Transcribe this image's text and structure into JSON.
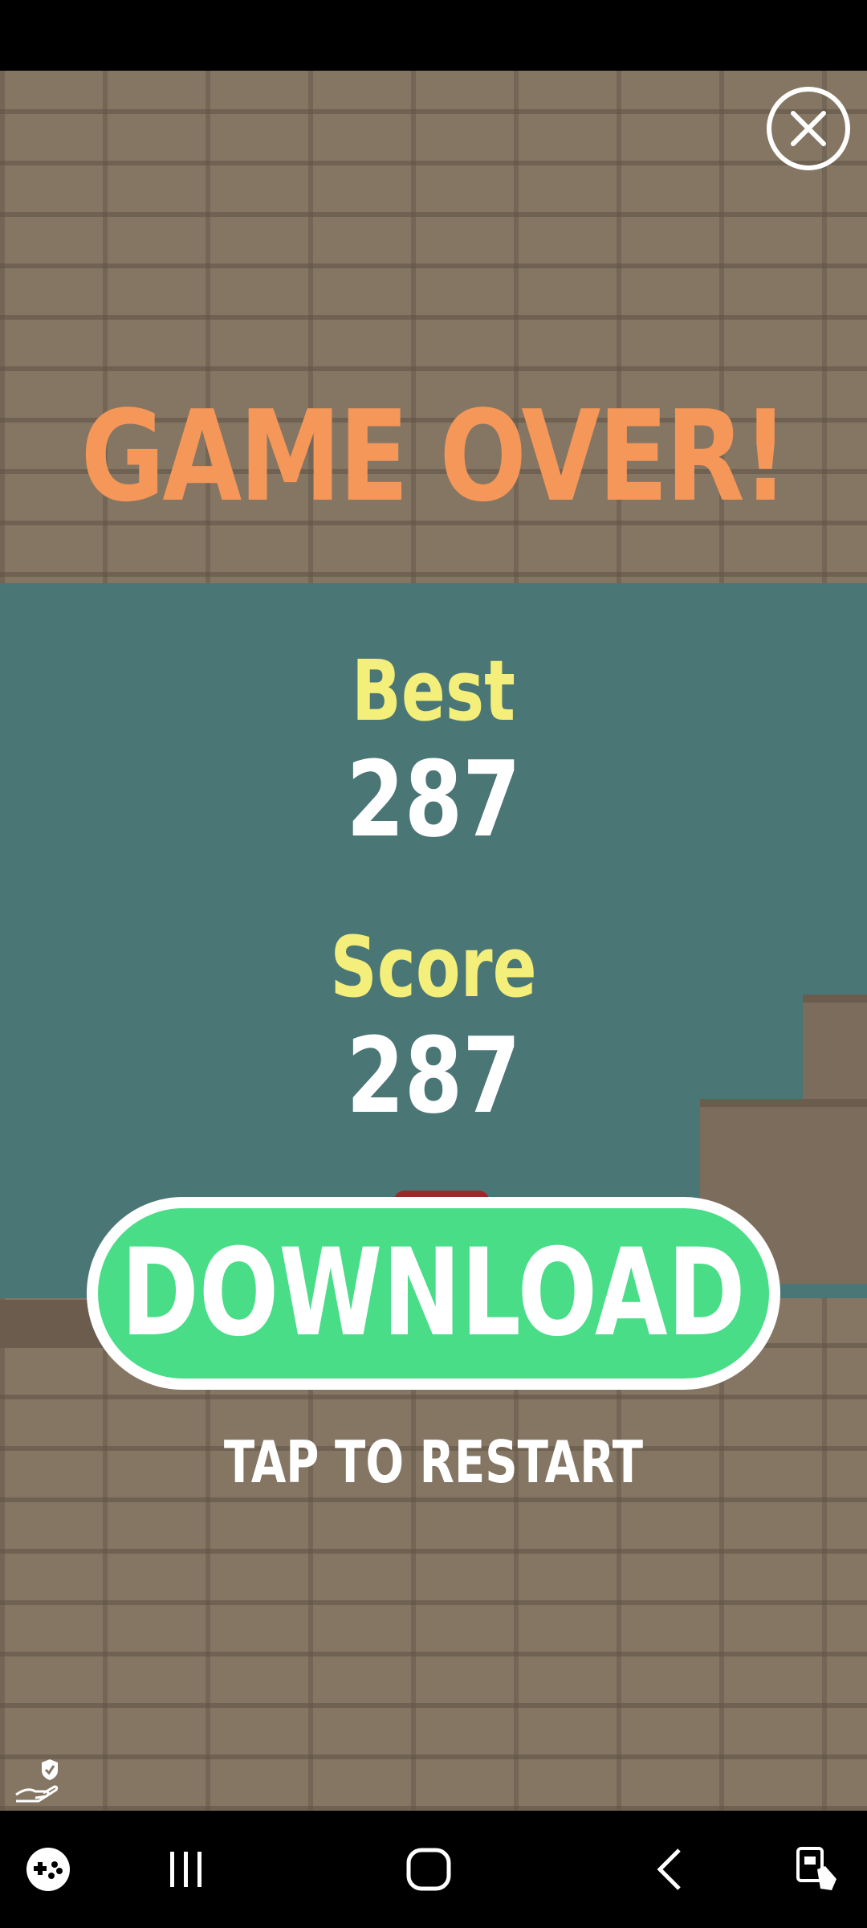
{
  "game": {
    "title": "GAME OVER!",
    "best_label": "Best",
    "best_value": "287",
    "score_label": "Score",
    "score_value": "287",
    "download_label": "DOWNLOAD",
    "restart_label": "TAP TO RESTART"
  },
  "icons": {
    "close": "close-icon",
    "ad_choices": "ad-privacy-icon",
    "nav_game": "game-launcher-icon",
    "nav_recents": "recents-icon",
    "nav_home": "home-icon",
    "nav_back": "back-icon",
    "nav_assist": "touch-assist-icon"
  },
  "colors": {
    "title": "#f59759",
    "label": "#f4ee7a",
    "panel": "#4a7675",
    "download": "#49dd88",
    "wall": "#857664"
  }
}
